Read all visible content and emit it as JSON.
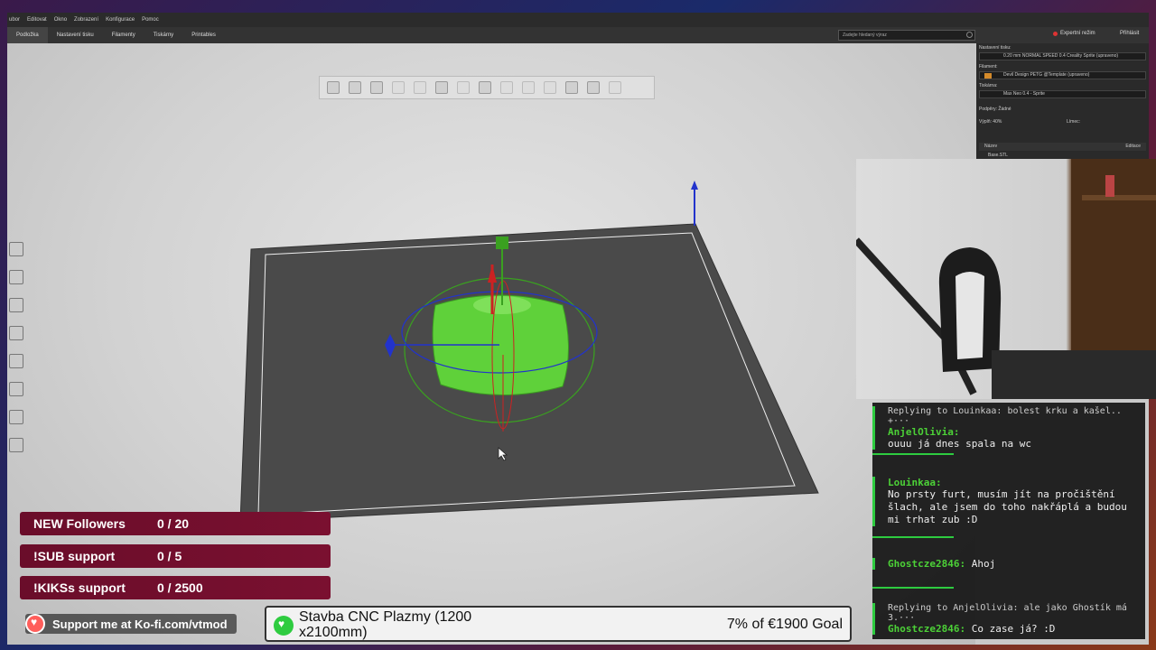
{
  "menubar": {
    "items": [
      "ubor",
      "Editovat",
      "Okno",
      "Zobrazení",
      "Konfigurace",
      "Pomoc"
    ]
  },
  "tabs": [
    {
      "label": "Podložka",
      "active": true
    },
    {
      "label": "Nastavení tisku"
    },
    {
      "label": "Filamenty"
    },
    {
      "label": "Tiskárny"
    },
    {
      "label": "Printables"
    }
  ],
  "search": {
    "placeholder": "Zadejte hledaný výraz"
  },
  "header": {
    "expert_mode": "Expertní režim",
    "login": "Přihlásit"
  },
  "panel": {
    "print_settings_label": "Nastavení tisku:",
    "print_profile": "0.20 mm NORMAL SPEED 0.4 Creality Sprite (upraveno)",
    "filament_label": "Filament:",
    "filament_profile": "Devil Design PETG @Template (upraveno)",
    "printer_label": "Tiskárna:",
    "printer_profile": "Max Neo 0.4 - Sprite",
    "supports_label": "Podpěry:",
    "supports_value": "Žádné",
    "infill_label": "Výplň:",
    "infill_value": "40%",
    "brim_label": "Límec:",
    "table_name_header": "Název",
    "table_edit_header": "Editace",
    "object_name": "Base.STL"
  },
  "chat": {
    "messages": [
      {
        "reply": "Replying to Louinkaa: bolest krku a kašel.. +···",
        "user": "AnjelOlivia:",
        "text": "ouuu já dnes spala na wc"
      },
      {
        "user": "Louinkaa:",
        "text": "No prsty furt, musím jít na pročištění šlach, ale jsem do toho nakřáplá a budou mi trhat zub :D"
      },
      {
        "user": "Ghostcze2846:",
        "text": "Ahoj"
      },
      {
        "reply": "Replying to AnjelOlivia: ale jako Ghostík má 3.···",
        "user": "Ghostcze2846:",
        "text": "Co zase já? :D"
      }
    ]
  },
  "goals": [
    {
      "label": "NEW Followers",
      "value": "0 / 20"
    },
    {
      "label": "!SUB support",
      "value": "0 / 5"
    },
    {
      "label": "!KIKSs support",
      "value": "0 / 2500"
    }
  ],
  "kofi": {
    "text": "Support me at Ko-fi.com/vtmod"
  },
  "donation": {
    "title": "Stavba CNC Plazmy (1200 x2100mm)",
    "goal": "7% of €1900 Goal",
    "progress_percent": 7
  },
  "colors": {
    "goal_bg": "#7a1030",
    "chat_accent": "#2ecc40",
    "model_green": "#5fd13a"
  }
}
